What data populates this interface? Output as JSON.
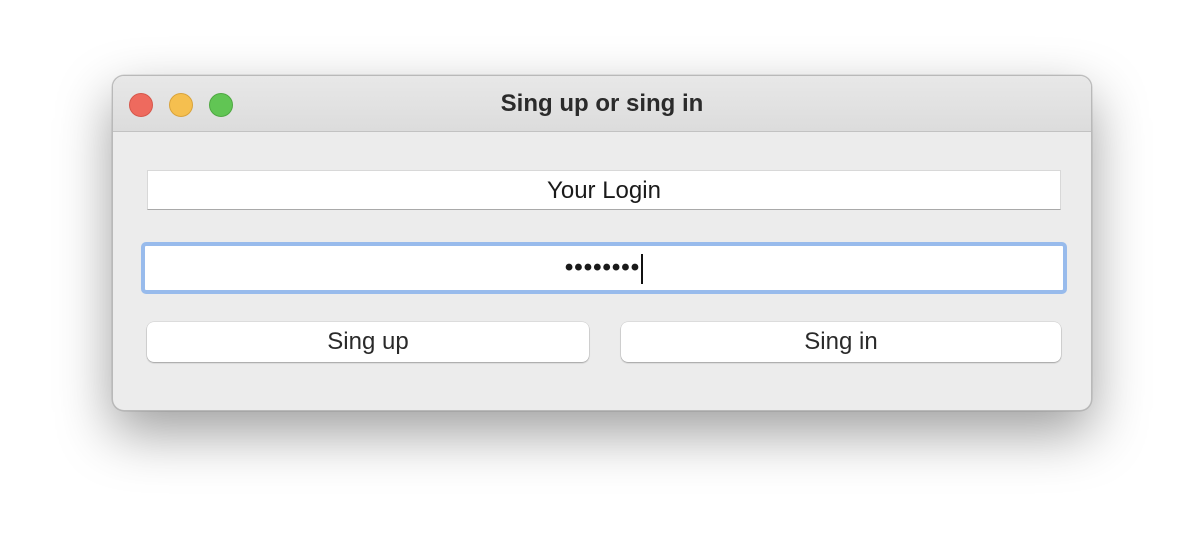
{
  "window": {
    "title": "Sing up or sing in",
    "controls": {
      "close": "close-button",
      "minimize": "minimize-button",
      "zoom": "zoom-button"
    },
    "colors": {
      "close": "#ee6a5e",
      "minimize": "#f5bf4f",
      "zoom": "#61c554",
      "focus_ring": "#98bbec"
    }
  },
  "form": {
    "login_field": {
      "value": "Your Login"
    },
    "password_field": {
      "value_masked": "••••••••"
    },
    "buttons": {
      "sign_up_label": "Sing up",
      "sign_in_label": "Sing in"
    }
  }
}
